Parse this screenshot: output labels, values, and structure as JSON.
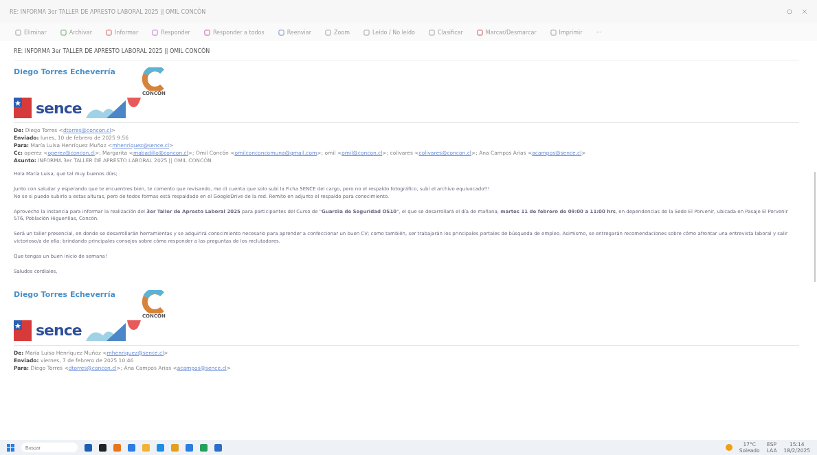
{
  "window": {
    "title": "RE: INFORMA 3er TALLER DE APRESTO LABORAL 2025 || OMIL CONCÓN"
  },
  "toolbar": [
    "Eliminar",
    "Archivar",
    "Informar",
    "Responder",
    "Responder a todos",
    "Reenviar",
    "Zoom",
    "Leído / No leído",
    "Clasificar",
    "Marcar/Desmarcar",
    "Imprimir",
    "···"
  ],
  "subject": "RE: INFORMA 3er TALLER DE APRESTO LABORAL 2025 || OMIL CONCÓN",
  "messages": [
    {
      "signature": {
        "name": "Diego Torres Echeverría",
        "sence": "sence",
        "concon": "CONCÓN"
      },
      "headers": [
        {
          "label": "De:",
          "parts": [
            {
              "kind": "text",
              "text": "Diego Torres <"
            },
            {
              "kind": "link",
              "text": "dtorres@concon.cl"
            },
            {
              "kind": "text",
              "text": ">"
            }
          ]
        },
        {
          "label": "Enviado:",
          "parts": [
            {
              "kind": "text",
              "text": "lunes, 10 de febrero de 2025 9:56"
            }
          ]
        },
        {
          "label": "Para:",
          "parts": [
            {
              "kind": "text",
              "text": "María Luisa Henríquez Muñoz <"
            },
            {
              "kind": "link",
              "text": "mhenriquez@sence.cl"
            },
            {
              "kind": "text",
              "text": ">"
            }
          ]
        },
        {
          "label": "Cc:",
          "parts": [
            {
              "kind": "text",
              "text": "operez <"
            },
            {
              "kind": "link",
              "text": "operez@concon.cl"
            },
            {
              "kind": "text",
              "text": ">; Margarita <"
            },
            {
              "kind": "link",
              "text": "mabadillo@concon.cl"
            },
            {
              "kind": "text",
              "text": ">; Omil Concón <"
            },
            {
              "kind": "link",
              "text": "omilconconcomuna@gmail.com"
            },
            {
              "kind": "text",
              "text": ">; omil <"
            },
            {
              "kind": "link",
              "text": "omil@concon.cl"
            },
            {
              "kind": "text",
              "text": ">; colivares <"
            },
            {
              "kind": "link",
              "text": "colivares@concon.cl"
            },
            {
              "kind": "text",
              "text": ">; Ana Campos Arias <"
            },
            {
              "kind": "link",
              "text": "acampos@sence.cl"
            },
            {
              "kind": "text",
              "text": ">"
            }
          ]
        },
        {
          "label": "Asunto:",
          "parts": [
            {
              "kind": "text",
              "text": "INFORMA 3er TALLER DE APRESTO LABORAL 2025 || OMIL CONCÓN"
            }
          ]
        }
      ],
      "body": [
        [
          "Hola María Luisa, que tal muy buenos días;"
        ],
        [
          "Junto con saludar y esperando que te encuentres bien, te comento que revisando, me di cuenta que solo subí la Ficha SENCE del cargo, pero no el respaldo fotográfico, subí el archivo equivocado!!!",
          "No se si puedo subirlo a estas alturas, pero de todos formas está respaldado en el GoogleDrive de la red. Remito en adjunto el respaldo para conocimiento."
        ],
        [
          "Aprovecho la instancia para informar la realización del **3er Taller de Apresto Laboral 2025** para participantes del Curso de \"**Guardia de Seguridad OS10**\", el que se desarrollará el día de mañana, **martes 11 de febrero de 09:00 a 11:00 hrs**, en dependencias de la Sede El Porvenir, ubicada en Pasaje El Porvenir 576, Población Higuerillas, Concón."
        ],
        [
          "Será un taller presencial, en donde se desarrollarán herramientas y se adquirirá conocimiento necesario para aprender a confeccionar un buen CV; como también, ser trabajarán los principales portales de búsqueda de empleo. Asimismo, se entregarán recomendaciones sobre cómo afrontar una entrevista laboral y salir victorioso/a de ella; brindando principales consejos sobre cómo responder a las preguntas de los reclutadores."
        ],
        [
          "Que tengas un buen inicio de semana!"
        ],
        [
          "Saludos cordiales,"
        ]
      ]
    },
    {
      "signature": {
        "name": "Diego Torres Echeverría",
        "sence": "sence",
        "concon": "CONCÓN"
      },
      "headers": [
        {
          "label": "De:",
          "parts": [
            {
              "kind": "text",
              "text": "María Luisa Henríquez Muñoz <"
            },
            {
              "kind": "link",
              "text": "mhenriquez@sence.cl"
            },
            {
              "kind": "text",
              "text": ">"
            }
          ]
        },
        {
          "label": "Enviado:",
          "parts": [
            {
              "kind": "text",
              "text": "viernes, 7 de febrero de 2025 10:46"
            }
          ]
        },
        {
          "label": "Para:",
          "parts": [
            {
              "kind": "text",
              "text": "Diego Torres <"
            },
            {
              "kind": "link",
              "text": "dtorres@concon.cl"
            },
            {
              "kind": "text",
              "text": ">; Ana Campos Arias <"
            },
            {
              "kind": "link",
              "text": "acampos@sence.cl"
            },
            {
              "kind": "text",
              "text": ">"
            }
          ]
        }
      ]
    }
  ],
  "taskbar": {
    "search": {
      "placeholder": "Buscar"
    },
    "weather": {
      "temp": "17°C",
      "desc": "Soleado"
    },
    "lang": [
      "ESP",
      "LAA"
    ],
    "time": "15:14",
    "date": "18/2/2025"
  }
}
